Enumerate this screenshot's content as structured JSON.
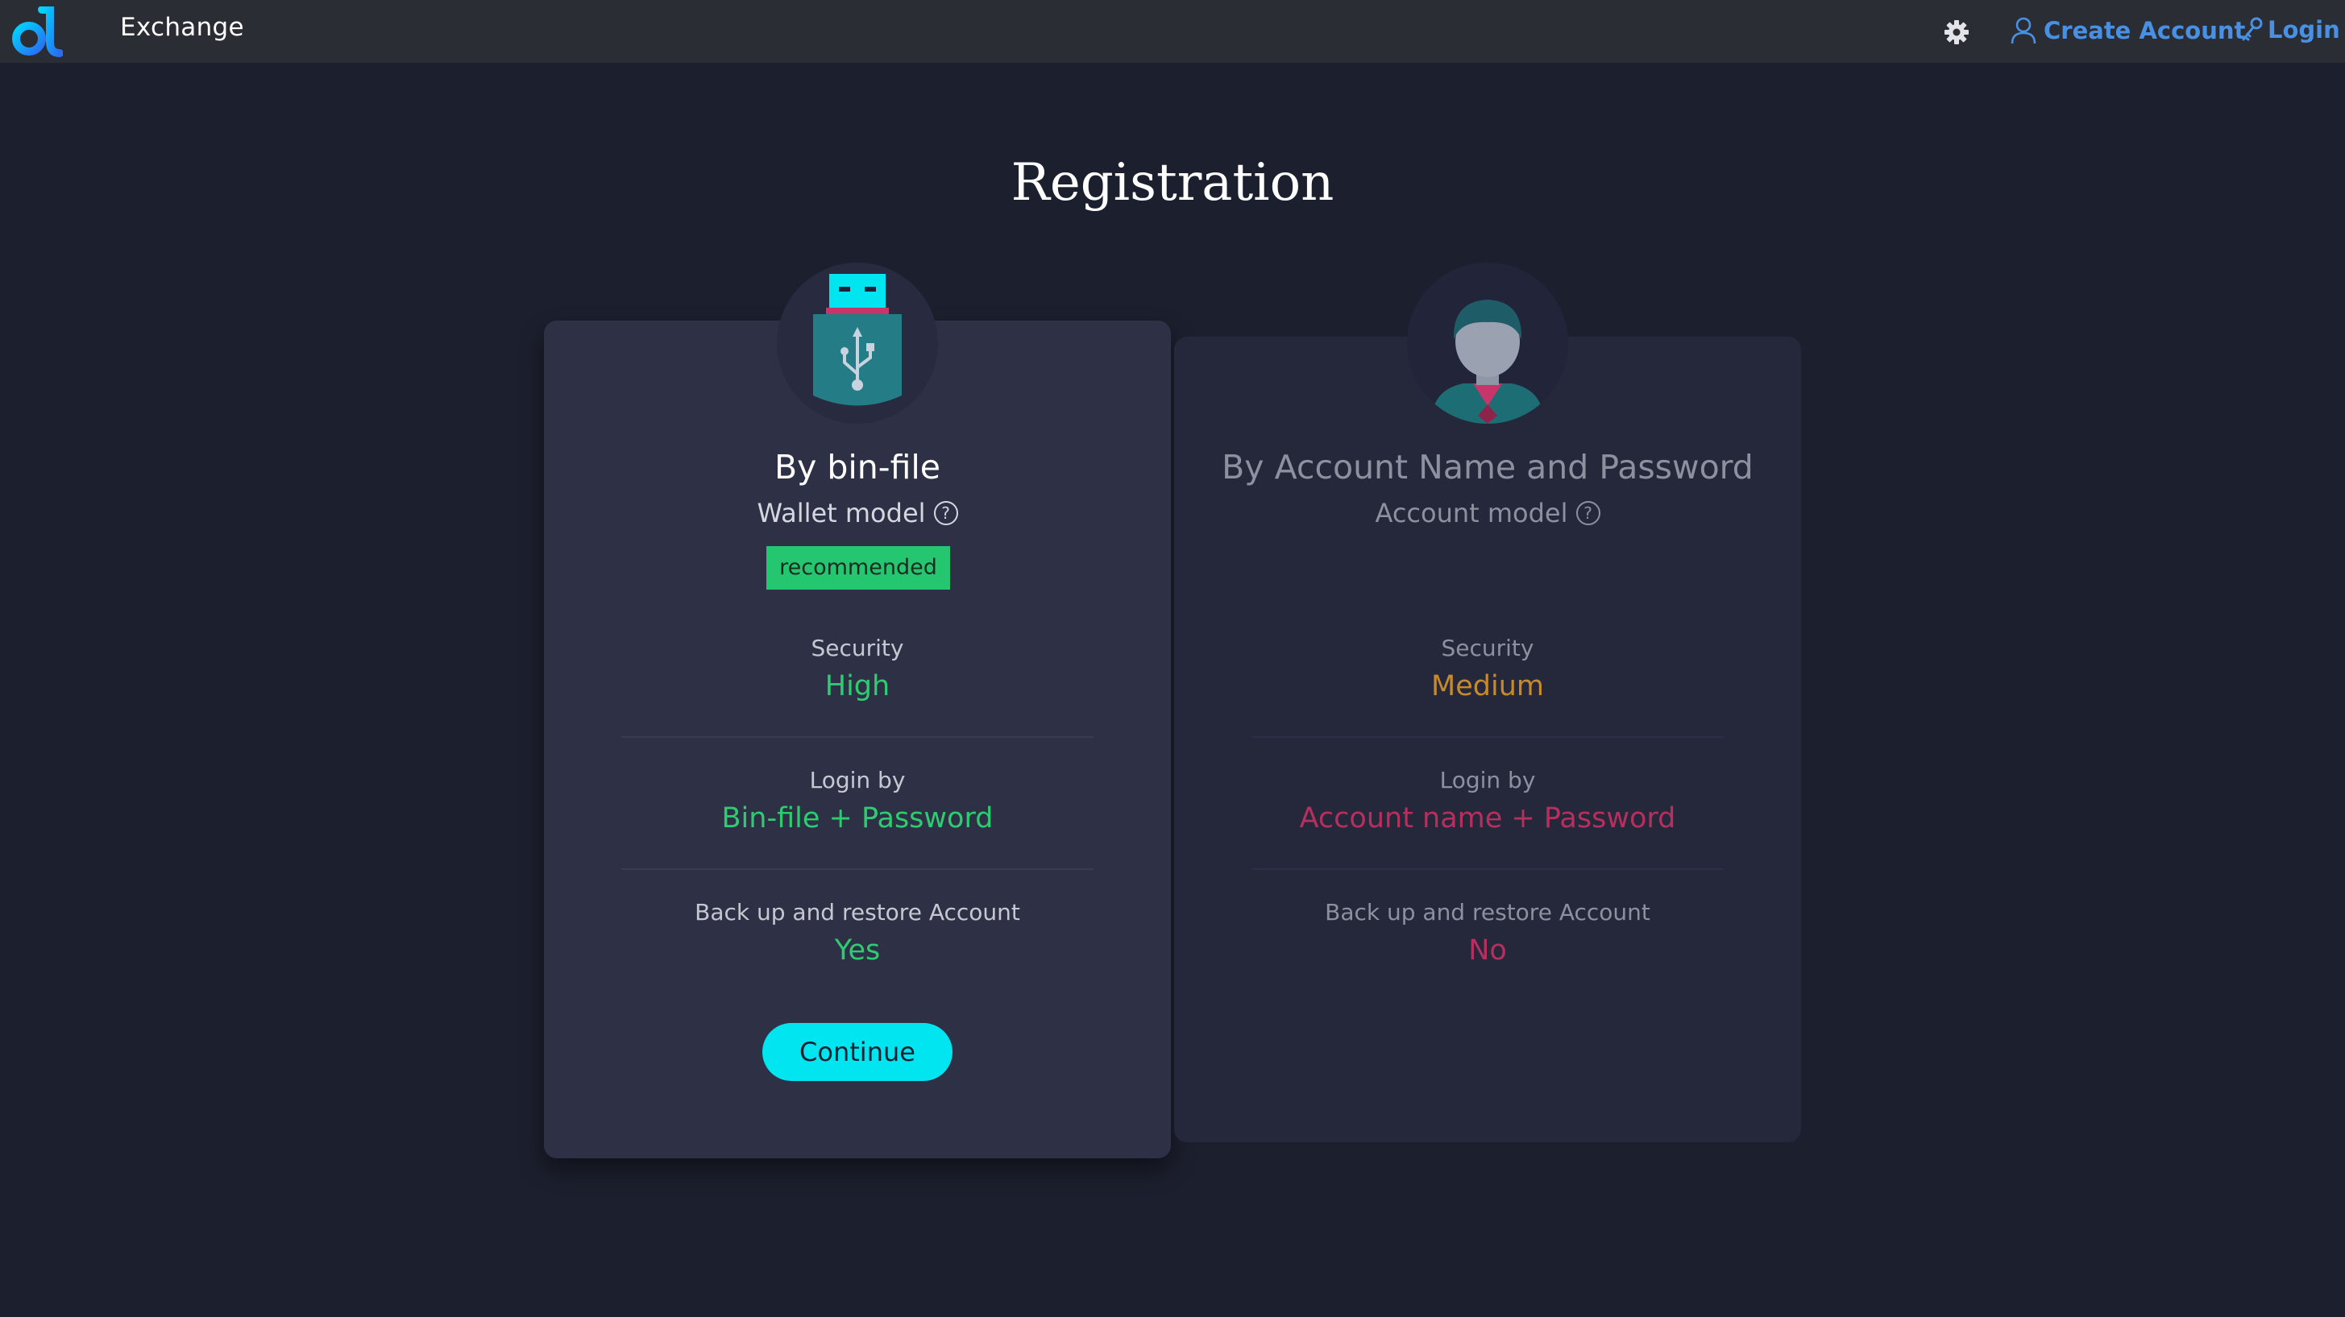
{
  "header": {
    "app_title": "Exchange",
    "create_account_label": "Create Account",
    "login_label": "Login",
    "icons": [
      "logo-icon",
      "gear-icon",
      "user-icon",
      "key-icon"
    ]
  },
  "page": {
    "title": "Registration"
  },
  "cards": [
    {
      "title": "By bin-file",
      "model": "Wallet model",
      "help": "?",
      "badge": "recommended",
      "icon": "usb-drive-icon",
      "rows": [
        {
          "label": "Security",
          "value": "High",
          "color": "#2ecc71"
        },
        {
          "label": "Login by",
          "value": "Bin-file + Password",
          "color": "#2ecc71"
        },
        {
          "label": "Back up and restore Account",
          "value": "Yes",
          "color": "#2ecc71"
        }
      ],
      "button": "Continue"
    },
    {
      "title": "By Account Name and Password",
      "model": "Account model",
      "help": "?",
      "icon": "user-avatar-icon",
      "rows": [
        {
          "label": "Security",
          "value": "Medium",
          "color": "#c68a2d"
        },
        {
          "label": "Login by",
          "value": "Account name + Password",
          "color": "#b5305e"
        },
        {
          "label": "Back up and restore Account",
          "value": "No",
          "color": "#b5305e"
        }
      ]
    }
  ],
  "colors": {
    "accent": "#00e5f0",
    "link": "#4a90e2",
    "good": "#2ecc71",
    "warn": "#c68a2d",
    "bad": "#b5305e"
  }
}
